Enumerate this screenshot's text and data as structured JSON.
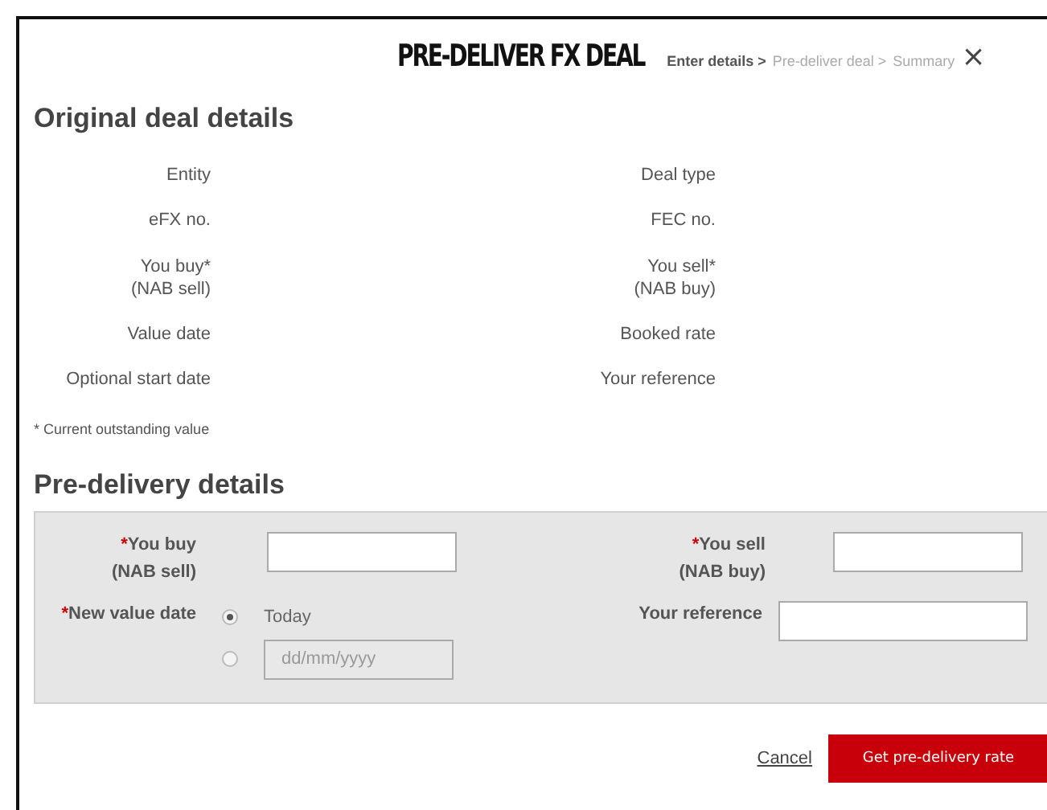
{
  "dialog": {
    "title": "PRE-DELIVER FX DEAL",
    "close": "×"
  },
  "steps": [
    {
      "label": "Enter details >",
      "selected": true
    },
    {
      "label": "Pre-deliver deal >",
      "selected": false
    },
    {
      "label": "Summary",
      "selected": false
    }
  ],
  "original": {
    "heading": "Original deal details",
    "rows": [
      {
        "left": "Entity",
        "right": "Deal type"
      },
      {
        "left": "eFX no.",
        "right": "FEC no."
      },
      {
        "left": "You buy*\n(NAB sell)",
        "right": "You sell*\n(NAB buy)"
      },
      {
        "left": "Value date",
        "right": "Booked rate"
      },
      {
        "left": "Optional start date",
        "right": "Your reference"
      }
    ],
    "footnote": "* Current outstanding value"
  },
  "predelivery": {
    "heading": "Pre-delivery details",
    "required_mark": "*",
    "you_buy": {
      "label": "You buy\n(NAB sell)",
      "required": true
    },
    "you_sell": {
      "label": "You sell\n(NAB buy)",
      "required": true
    },
    "new_value_date": {
      "label": "New value date",
      "required": true,
      "options": [
        {
          "kind": "text",
          "label": "Today",
          "selected": true
        },
        {
          "kind": "date",
          "placeholder": "dd/mm/yyyy",
          "selected": false,
          "disabled": true
        }
      ]
    },
    "your_reference": {
      "label": "Your reference",
      "required": false
    }
  },
  "buttons": {
    "cancel": "Cancel",
    "submit": "Get pre-delivery rate"
  }
}
